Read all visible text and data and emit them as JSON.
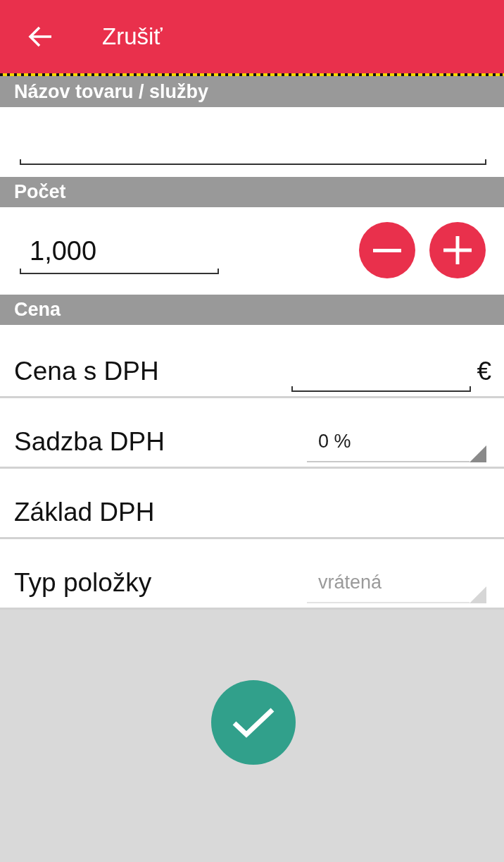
{
  "app_bar": {
    "title": "Zrušiť"
  },
  "name_section": {
    "header": "Názov tovaru / služby"
  },
  "quantity_section": {
    "header": "Počet",
    "value": "1,000"
  },
  "price_section": {
    "header": "Cena",
    "rows": [
      {
        "kind": "input",
        "label": "Cena s DPH",
        "suffix": "€"
      },
      {
        "kind": "dropdown",
        "label": "Sadzba DPH",
        "value": "0 %",
        "disabled": false
      },
      {
        "kind": "plain",
        "label": "Základ DPH"
      },
      {
        "kind": "dropdown",
        "label": "Typ položky",
        "value": "vrátená",
        "disabled": true
      }
    ]
  }
}
